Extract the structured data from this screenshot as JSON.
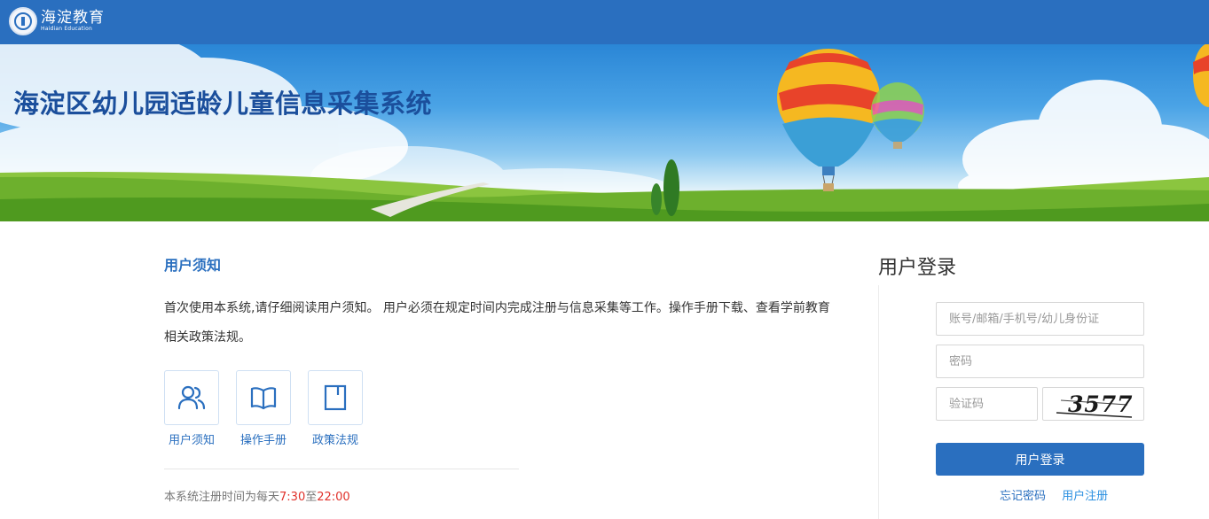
{
  "header": {
    "logo_cn": "海淀教育",
    "logo_en": "Haidian Education"
  },
  "banner": {
    "title": "海淀区幼儿园适龄儿童信息采集系统"
  },
  "notice": {
    "heading": "用户须知",
    "text": "首次使用本系统,请仔细阅读用户须知。 用户必须在规定时间内完成注册与信息采集等工作。操作手册下载、查看学前教育相关政策法规。",
    "links": [
      {
        "label": "用户须知",
        "icon": "users-icon"
      },
      {
        "label": "操作手册",
        "icon": "book-icon"
      },
      {
        "label": "政策法规",
        "icon": "document-icon"
      }
    ],
    "reg_time_prefix": "本系统注册时间为每天",
    "reg_time_start": "7:30",
    "reg_time_mid": "至",
    "reg_time_end": "22:00"
  },
  "login": {
    "title": "用户登录",
    "account_placeholder": "账号/邮箱/手机号/幼儿身份证",
    "password_placeholder": "密码",
    "captcha_placeholder": "验证码",
    "captcha_text": "3577",
    "submit_label": "用户登录",
    "forgot_label": "忘记密码",
    "register_label": "用户注册"
  },
  "colors": {
    "primary": "#2a6fbf",
    "highlight": "#e0312b"
  }
}
